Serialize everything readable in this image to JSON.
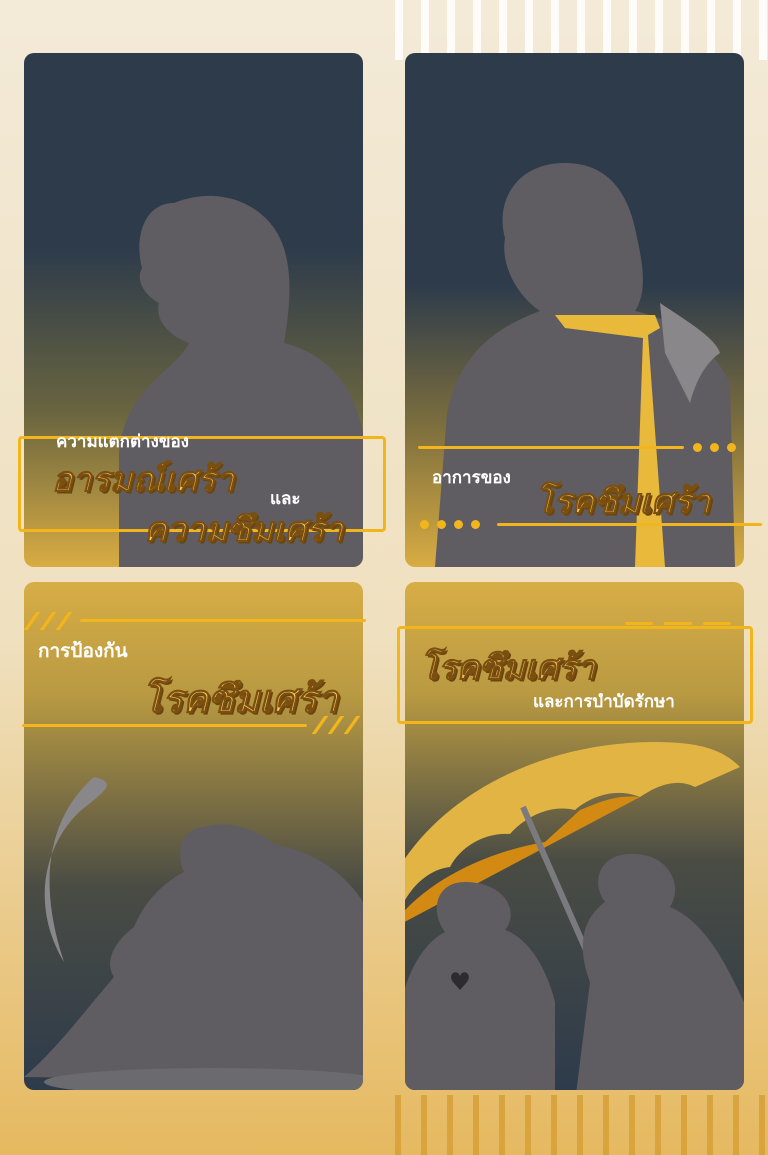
{
  "panels": {
    "p1": {
      "line1": "ความแตกต่างของ",
      "line2": "อารมณ์เศร้า",
      "conj": "และ",
      "line3": "ความซึมเศร้า"
    },
    "p2": {
      "line1": "อาการของ",
      "line2": "โรคซึมเศร้า"
    },
    "p3": {
      "line1": "การป้องกัน",
      "line2": "โรคซึมเศร้า"
    },
    "p4": {
      "line1": "โรคซึมเศร้า",
      "line2": "และการบำบัดรักษา"
    }
  },
  "icons": {
    "p1": "person-silhouette-profile",
    "p2": "person-silhouette-back",
    "p3": "sitting-person-silhouette",
    "p4": "umbrella-two-people-silhouette"
  },
  "colors": {
    "navy": "#2d3b4b",
    "gold": "#f2b51b",
    "silhouette": "#5f5d62",
    "background": "#f3ead8"
  }
}
